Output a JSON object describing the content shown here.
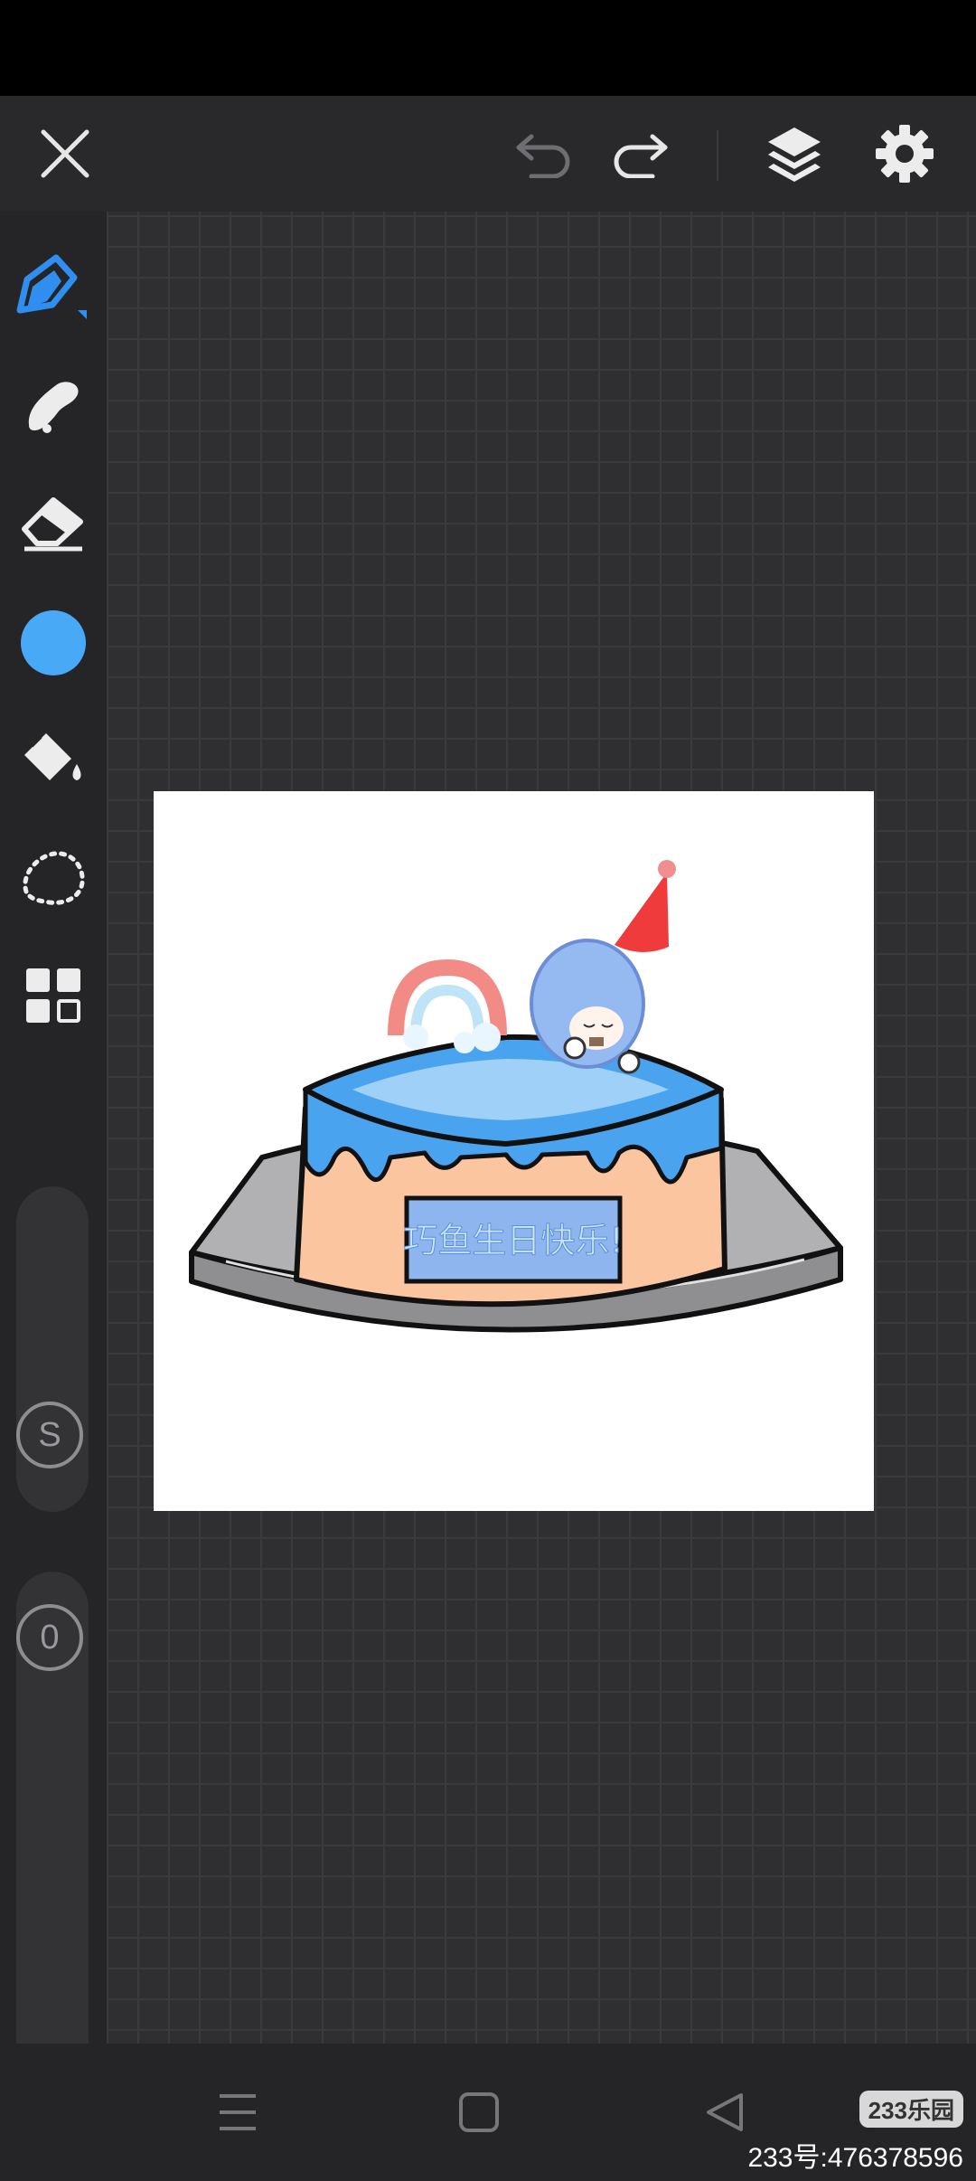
{
  "top_bar": {
    "icons": [
      "close-icon",
      "undo-icon",
      "redo-icon",
      "layers-icon",
      "settings-icon"
    ]
  },
  "tools": [
    "brush-tool",
    "smudge-tool",
    "eraser-tool",
    "color-picker",
    "fill-bucket-tool",
    "lasso-selection-tool",
    "gallery-grid"
  ],
  "current_color": "#48aaf6",
  "sliders": {
    "size_label": "S",
    "opacity_label": "0"
  },
  "artwork": {
    "cake_plaque_text": "巧鱼生日快乐!"
  },
  "nav_bar": {
    "icons": [
      "menu-icon",
      "home-icon",
      "back-icon"
    ]
  },
  "watermark": {
    "logo": "233乐园",
    "text": "233号:476378596"
  }
}
